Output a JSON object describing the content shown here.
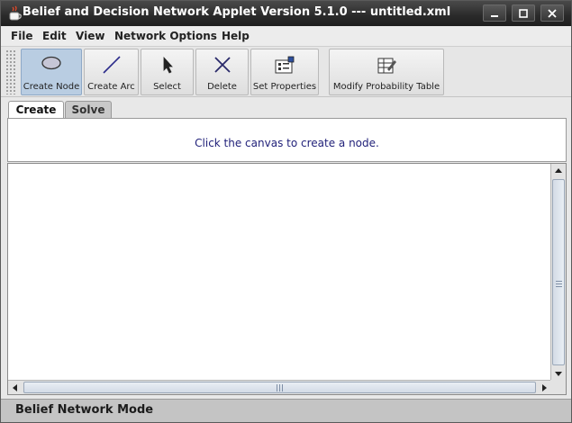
{
  "window": {
    "title": "Belief and Decision Network Applet Version 5.1.0 --- untitled.xml",
    "controls": [
      "minimize-icon",
      "maximize-icon",
      "close-icon"
    ]
  },
  "menu": [
    {
      "label": "File"
    },
    {
      "label": "Edit"
    },
    {
      "label": "View"
    },
    {
      "label": "Network Options"
    },
    {
      "label": "Help"
    }
  ],
  "toolbar": {
    "buttons": [
      {
        "label": "Create Node",
        "icon": "ellipse-node-icon",
        "active": true
      },
      {
        "label": "Create Arc",
        "icon": "diagonal-line-icon",
        "active": false
      },
      {
        "label": "Select",
        "icon": "pointer-arrow-icon",
        "active": false
      },
      {
        "label": "Delete",
        "icon": "x-delete-icon",
        "active": false
      },
      {
        "label": "Set Properties",
        "icon": "properties-panel-icon",
        "active": false
      },
      {
        "label": "Modify Probability Table",
        "icon": "table-edit-icon",
        "active": false
      }
    ]
  },
  "tabs": [
    {
      "label": "Create",
      "selected": true
    },
    {
      "label": "Solve",
      "selected": false
    }
  ],
  "message": "Click the canvas to create a node.",
  "status": "Belief Network Mode",
  "colors": {
    "active_button": "#b9cde2",
    "message_text": "#22227a",
    "titlebar": "#2a2a2a"
  }
}
